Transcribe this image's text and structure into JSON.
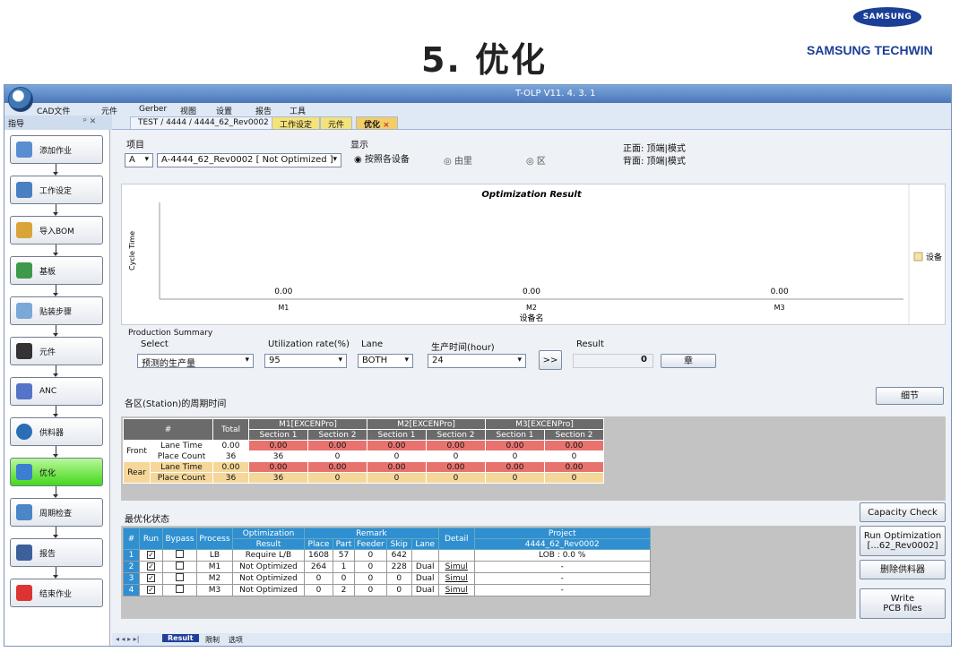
{
  "slide": {
    "title": "5. 优化",
    "brand_badge": "SAMSUNG",
    "brand_name": "SAMSUNG TECHWIN"
  },
  "app": {
    "title": "T-OLP V11. 4. 3. 1",
    "menu": [
      "CAD文件",
      "元件",
      "Gerber",
      "视图",
      "设置",
      "报告",
      "工具"
    ],
    "nav_header": "指导",
    "nav_pin": "ᵖ ✕",
    "doc_tabs": [
      "TEST / 4444 / 4444_62_Rev0002",
      "工作设定",
      "元件",
      "优化"
    ],
    "tab_close": "×"
  },
  "nav": [
    {
      "label": "添加作业",
      "icon": "add-job-icon"
    },
    {
      "label": "工作设定",
      "icon": "job-settings-icon"
    },
    {
      "label": "导入BOM",
      "icon": "import-bom-icon"
    },
    {
      "label": "基板",
      "icon": "board-icon"
    },
    {
      "label": "贴装步骤",
      "icon": "mount-steps-icon"
    },
    {
      "label": "元件",
      "icon": "component-icon"
    },
    {
      "label": "ANC",
      "icon": "anc-icon"
    },
    {
      "label": "供料器",
      "icon": "feeder-icon"
    },
    {
      "label": "优化",
      "icon": "optimize-icon"
    },
    {
      "label": "周期检查",
      "icon": "cycle-check-icon"
    },
    {
      "label": "报告",
      "icon": "report-icon"
    },
    {
      "label": "结束作业",
      "icon": "end-job-icon"
    }
  ],
  "item": {
    "label": "项目",
    "code": "A",
    "project": "A-4444_62_Rev0002 [ Not Optimized ]"
  },
  "display": {
    "label": "显示",
    "options": [
      "按照各设备",
      "由里",
      "区"
    ],
    "selected": 0
  },
  "mode": {
    "front": "正面: 顶端|模式",
    "rear": "背面: 顶端|模式"
  },
  "chart_data": {
    "type": "bar",
    "title": "Optimization Result",
    "categories": [
      "M1",
      "M2",
      "M3"
    ],
    "values": [
      0,
      0,
      0
    ],
    "value_labels": [
      "0.00",
      "0.00",
      "0.00"
    ],
    "xlabel": "设备名",
    "ylabel": "Cycle Time",
    "legend": [
      "设备"
    ],
    "legend_position": "right"
  },
  "production": {
    "title": "Production Summary",
    "select_label": "Select",
    "select_value": "预测的生产量",
    "util_label": "Utilization rate(%)",
    "util_value": "95",
    "lane_label": "Lane",
    "lane_value": "BOTH",
    "time_label": "生产时间(hour)",
    "time_value": "24",
    "go": ">>",
    "result_label": "Result",
    "result_value": "0",
    "unit_btn": "章"
  },
  "station": {
    "title": "各区(Station)的周期时间",
    "detail_btn": "细节",
    "headers": {
      "hash": "#",
      "total": "Total",
      "machines": [
        "M1[EXCENPro]",
        "M2[EXCENPro]",
        "M3[EXCENPro]"
      ],
      "sections": [
        "Section 1",
        "Section 2"
      ]
    },
    "rows": [
      {
        "group": "Front",
        "label": "Lane Time",
        "total": "0.00",
        "vals": [
          "0.00",
          "0.00",
          "0.00",
          "0.00",
          "0.00",
          "0.00"
        ]
      },
      {
        "group": "",
        "label": "Place Count",
        "total": "36",
        "vals": [
          "36",
          "0",
          "0",
          "0",
          "0",
          "0"
        ]
      },
      {
        "group": "Rear",
        "label": "Lane Time",
        "total": "0.00",
        "vals": [
          "0.00",
          "0.00",
          "0.00",
          "0.00",
          "0.00",
          "0.00"
        ]
      },
      {
        "group": "",
        "label": "Place Count",
        "total": "36",
        "vals": [
          "36",
          "0",
          "0",
          "0",
          "0",
          "0"
        ]
      }
    ]
  },
  "optstate": {
    "title": "最优化状态",
    "headers": {
      "hash": "#",
      "run": "Run",
      "bypass": "Bypass",
      "process": "Process",
      "opt1": "Optimization",
      "opt2": "Result",
      "remark": "Remark",
      "place": "Place",
      "part": "Part",
      "feeder": "Feeder",
      "skip": "Skip",
      "lane": "Lane",
      "detail": "Detail",
      "project": "Project",
      "project_name": "4444_62_Rev0002"
    },
    "rows": [
      {
        "n": "1",
        "run": true,
        "bypass": false,
        "process": "LB",
        "result": "Require L/B",
        "place": "1608",
        "part": "57",
        "feeder": "0",
        "skip": "642",
        "lane": "",
        "detail": "",
        "project": "LOB : 0.0 %"
      },
      {
        "n": "2",
        "run": true,
        "bypass": false,
        "process": "M1",
        "result": "Not Optimized",
        "place": "264",
        "part": "1",
        "feeder": "0",
        "skip": "228",
        "lane": "Dual",
        "detail": "Simul",
        "project": "-"
      },
      {
        "n": "3",
        "run": true,
        "bypass": false,
        "process": "M2",
        "result": "Not Optimized",
        "place": "0",
        "part": "0",
        "feeder": "0",
        "skip": "0",
        "lane": "Dual",
        "detail": "Simul",
        "project": "-"
      },
      {
        "n": "4",
        "run": true,
        "bypass": false,
        "process": "M3",
        "result": "Not Optimized",
        "place": "0",
        "part": "2",
        "feeder": "0",
        "skip": "0",
        "lane": "Dual",
        "detail": "Simul",
        "project": "-"
      }
    ]
  },
  "side_buttons": {
    "capacity": "Capacity Check",
    "run_opt_1": "Run Optimization",
    "run_opt_2": "[...62_Rev0002]",
    "delete_feeder": "删除供料器",
    "write_1": "Write",
    "write_2": "PCB files"
  },
  "status_tabs": [
    "Result",
    "限制",
    "选项"
  ],
  "status_nav": "◂ ◂ ▸ ▸|"
}
